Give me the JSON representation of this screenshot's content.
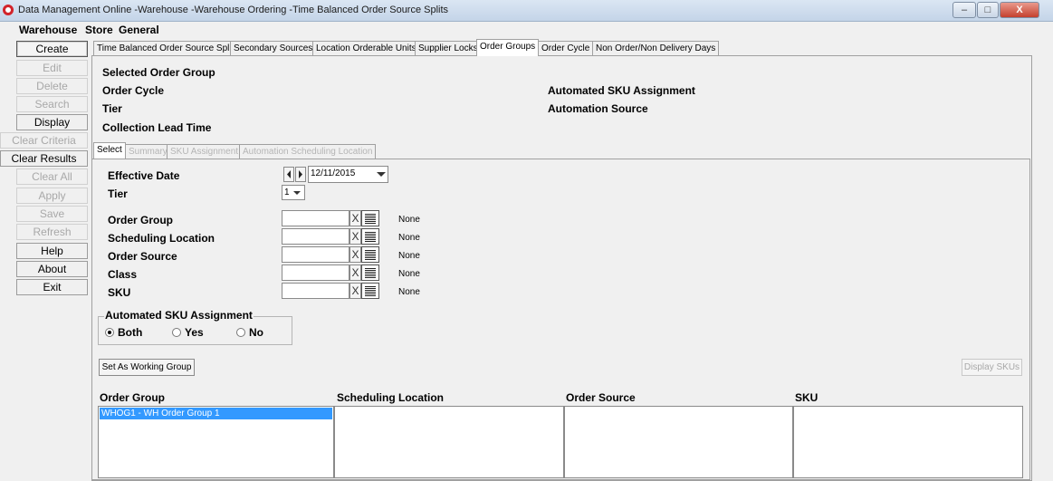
{
  "window": {
    "title": "Data Management Online -Warehouse -Warehouse Ordering -Time Balanced Order Source Splits",
    "minimize": "–",
    "maximize": "□",
    "close": "X"
  },
  "menu": [
    "Warehouse",
    "Store",
    "General"
  ],
  "sidebar": {
    "buttons": [
      {
        "label": "Create",
        "enabled": true
      },
      {
        "label": "Edit",
        "enabled": false
      },
      {
        "label": "Delete",
        "enabled": false
      },
      {
        "label": "Search",
        "enabled": false
      },
      {
        "label": "Display",
        "enabled": true
      },
      {
        "label": "Clear Criteria",
        "enabled": false
      },
      {
        "label": "Clear Results",
        "enabled": true
      },
      {
        "label": "Clear All",
        "enabled": false
      },
      {
        "label": "Apply",
        "enabled": false
      },
      {
        "label": "Save",
        "enabled": false
      },
      {
        "label": "Refresh",
        "enabled": false
      },
      {
        "label": "Help",
        "enabled": true
      },
      {
        "label": "About",
        "enabled": true
      },
      {
        "label": "Exit",
        "enabled": true
      }
    ]
  },
  "tabs": [
    "Time Balanced Order Source Splits",
    "Secondary Sources",
    "Location Orderable Units",
    "Supplier Locks",
    "Order Groups",
    "Order Cycle",
    "Non Order/Non Delivery Days"
  ],
  "active_tab": "Order Groups",
  "header": {
    "selected_order_group": "Selected Order Group",
    "order_cycle": "Order Cycle",
    "tier": "Tier",
    "collection_lead_time": "Collection Lead Time",
    "automated_sku_assignment": "Automated SKU Assignment",
    "automation_source": "Automation Source"
  },
  "subtabs": [
    "Select",
    "Summary",
    "SKU Assignment",
    "Automation Scheduling Location"
  ],
  "form": {
    "effective_date_label": "Effective Date",
    "effective_date_value": "12/11/2015",
    "tier_label": "Tier",
    "tier_value": "1",
    "lookup_fields": [
      {
        "label": "Order Group",
        "value": "",
        "description": "None"
      },
      {
        "label": "Scheduling Location",
        "value": "",
        "description": "None"
      },
      {
        "label": "Order Source",
        "value": "",
        "description": "None"
      },
      {
        "label": "Class",
        "value": "",
        "description": "None"
      },
      {
        "label": "SKU",
        "value": "",
        "description": "None"
      }
    ],
    "clear_glyph": "X"
  },
  "automated_group": {
    "title": "Automated SKU Assignment",
    "options": [
      "Both",
      "Yes",
      "No"
    ],
    "selected": "Both"
  },
  "buttons": {
    "set_working_group": "Set As Working Group",
    "display_skus": "Display SKUs"
  },
  "results": {
    "columns": [
      "Order Group",
      "Scheduling Location",
      "Order Source",
      "SKU"
    ],
    "order_groups": [
      "WHOG1 - WH Order Group 1"
    ]
  },
  "colors": {
    "selection": "#3399ff",
    "app_icon": "#d2232a",
    "close_button": "#c4402e"
  }
}
